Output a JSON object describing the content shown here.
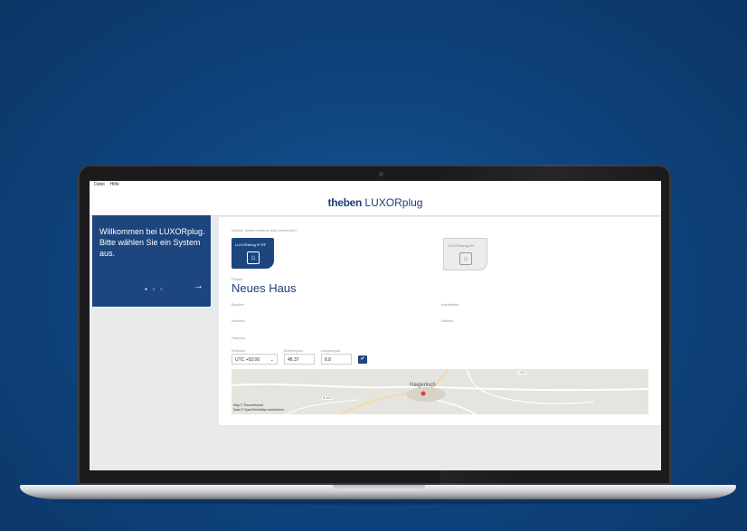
{
  "app": {
    "menu": [
      "Datei",
      "Hilfe"
    ],
    "brand_bold": "theben",
    "brand_product": "LUXORplug"
  },
  "welcome": {
    "text": "Willkommen bei LUXORplug. Bitte wählen Sie ein System aus.",
    "next_icon": "arrow-right-icon"
  },
  "system": {
    "question": "Welche Systemvariante wird verwendet?",
    "options": [
      {
        "label": "LUXORliving IP RF",
        "icon": "wifi-house-icon",
        "selected": true
      },
      {
        "label": "LUXORliving IP1",
        "icon": "house-icon",
        "selected": false
      }
    ]
  },
  "project": {
    "label": "Projekt",
    "name": "Neues Haus",
    "fields": {
      "bauherr": "Bauherr",
      "installateur": "Installateur",
      "adresse": "Adresse",
      "notizen": "Notizen"
    }
  },
  "location": {
    "label": "Standort",
    "timezone_label": "Zeitzone",
    "timezone_value": "UTC +02:00",
    "latitude_label": "Breitengrad",
    "latitude_value": "48.37",
    "longitude_label": "Längengrad",
    "longitude_value": "8.8",
    "confirm_icon": "check-icon"
  },
  "map": {
    "town": "Haigerloch",
    "credit_line1": "Map © Thunderforest",
    "credit_line2": "Data © OpenStreetMap contributors",
    "road_labels": [
      "L 415",
      "B 463"
    ]
  },
  "colors": {
    "brand_blue": "#1d457e",
    "background_blue": "#0f4580"
  }
}
